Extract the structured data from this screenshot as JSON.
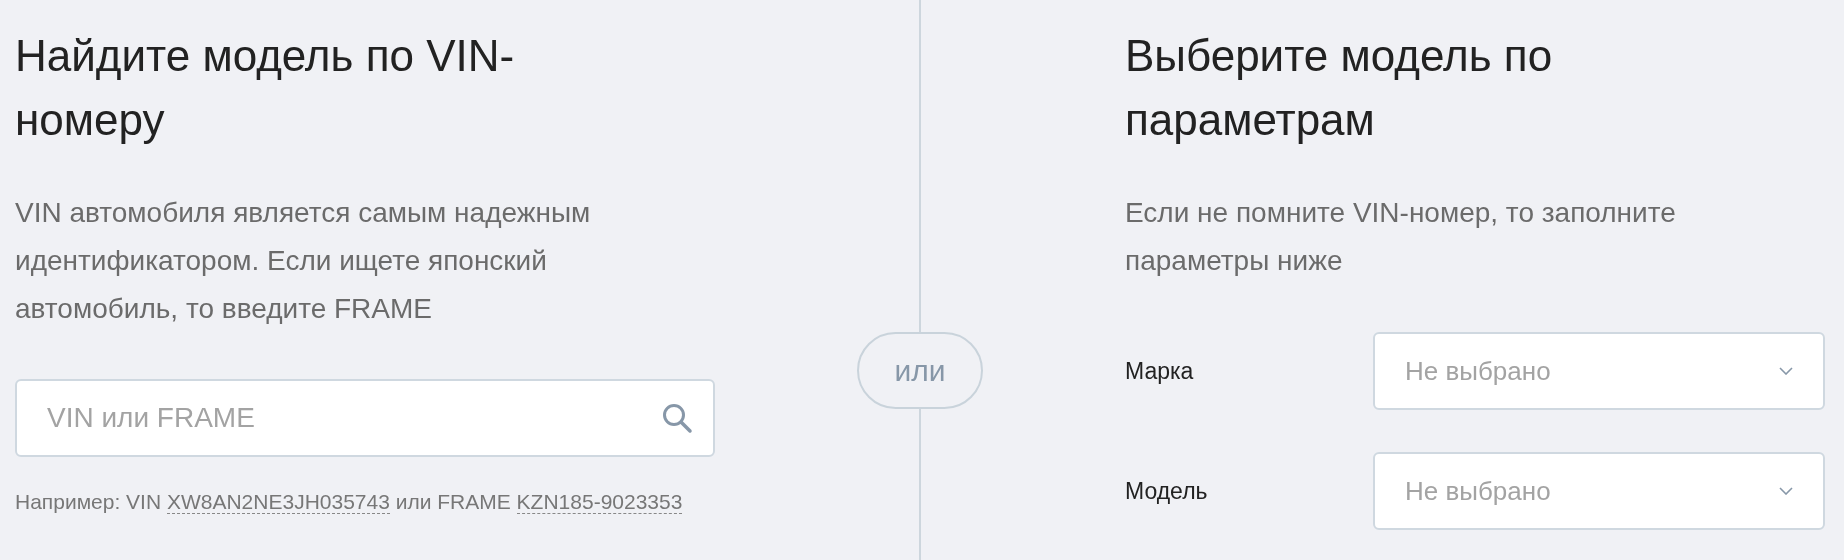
{
  "vin_search": {
    "title": "Найдите модель по VIN-номеру",
    "description": "VIN автомобиля является самым надежным идентификатором. Если ищете японский автомобиль, то введите FRAME",
    "search_field": {
      "placeholder": "VIN или FRAME"
    },
    "example": [
      {
        "kind": "text",
        "text": "Например: VIN "
      },
      {
        "kind": "link",
        "text": "XW8AN2NE3JH035743"
      },
      {
        "kind": "text",
        "text": " или FRAME "
      },
      {
        "kind": "link",
        "text": "KZN185-9023353"
      }
    ]
  },
  "separator": "или",
  "params": {
    "title": "Выберите модель по параметрам",
    "description": "Если не помните VIN-номер, то заполните параметры ниже",
    "fields": [
      {
        "label": "Марка",
        "placeholder": "Не выбрано"
      },
      {
        "label": "Модель",
        "placeholder": "Не выбрано"
      }
    ]
  }
}
